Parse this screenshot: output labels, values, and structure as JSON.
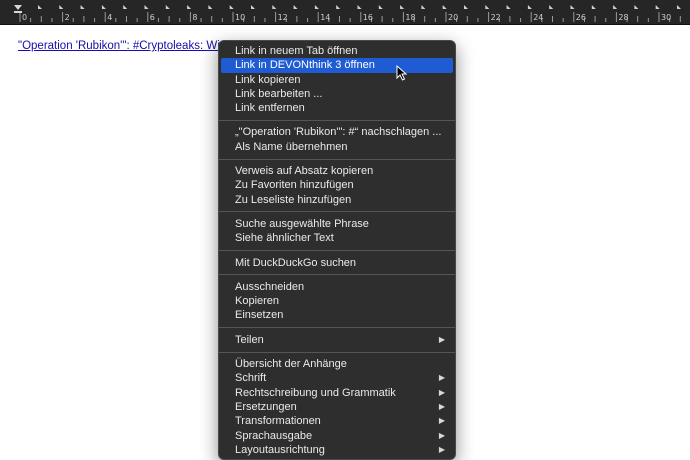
{
  "ruler": {
    "labels": [
      "0",
      "2",
      "4",
      "6",
      "8",
      "10",
      "12",
      "14",
      "16",
      "18",
      "20",
      "22",
      "24",
      "26",
      "28",
      "30"
    ]
  },
  "document": {
    "link_text": "\"Operation 'Rubikon'\": #Cryptoleaks: Wie"
  },
  "menu": {
    "groups": [
      [
        {
          "label": "Link in neuem Tab öffnen"
        },
        {
          "label": "Link in DEVONthink 3 öffnen",
          "highlighted": true
        },
        {
          "label": "Link kopieren"
        },
        {
          "label": "Link bearbeiten ..."
        },
        {
          "label": "Link entfernen"
        }
      ],
      [
        {
          "label": "„\"Operation 'Rubikon'\": #“ nachschlagen ..."
        },
        {
          "label": "Als Name übernehmen"
        }
      ],
      [
        {
          "label": "Verweis auf Absatz kopieren"
        },
        {
          "label": "Zu Favoriten hinzufügen"
        },
        {
          "label": "Zu Leseliste hinzufügen"
        }
      ],
      [
        {
          "label": "Suche ausgewählte Phrase"
        },
        {
          "label": "Siehe ähnlicher Text"
        }
      ],
      [
        {
          "label": "Mit DuckDuckGo suchen"
        }
      ],
      [
        {
          "label": "Ausschneiden"
        },
        {
          "label": "Kopieren"
        },
        {
          "label": "Einsetzen"
        }
      ],
      [
        {
          "label": "Teilen",
          "submenu": true
        }
      ],
      [
        {
          "label": "Übersicht der Anhänge"
        },
        {
          "label": "Schrift",
          "submenu": true
        },
        {
          "label": "Rechtschreibung und Grammatik",
          "submenu": true
        },
        {
          "label": "Ersetzungen",
          "submenu": true
        },
        {
          "label": "Transformationen",
          "submenu": true
        },
        {
          "label": "Sprachausgabe",
          "submenu": true
        },
        {
          "label": "Layoutausrichtung",
          "submenu": true
        }
      ]
    ],
    "submenu_glyph": "▶",
    "highlight_color": "#1f5bd3"
  },
  "icons": {
    "cursor": "mouse-pointer-icon",
    "submenu": "chevron-right-icon"
  }
}
